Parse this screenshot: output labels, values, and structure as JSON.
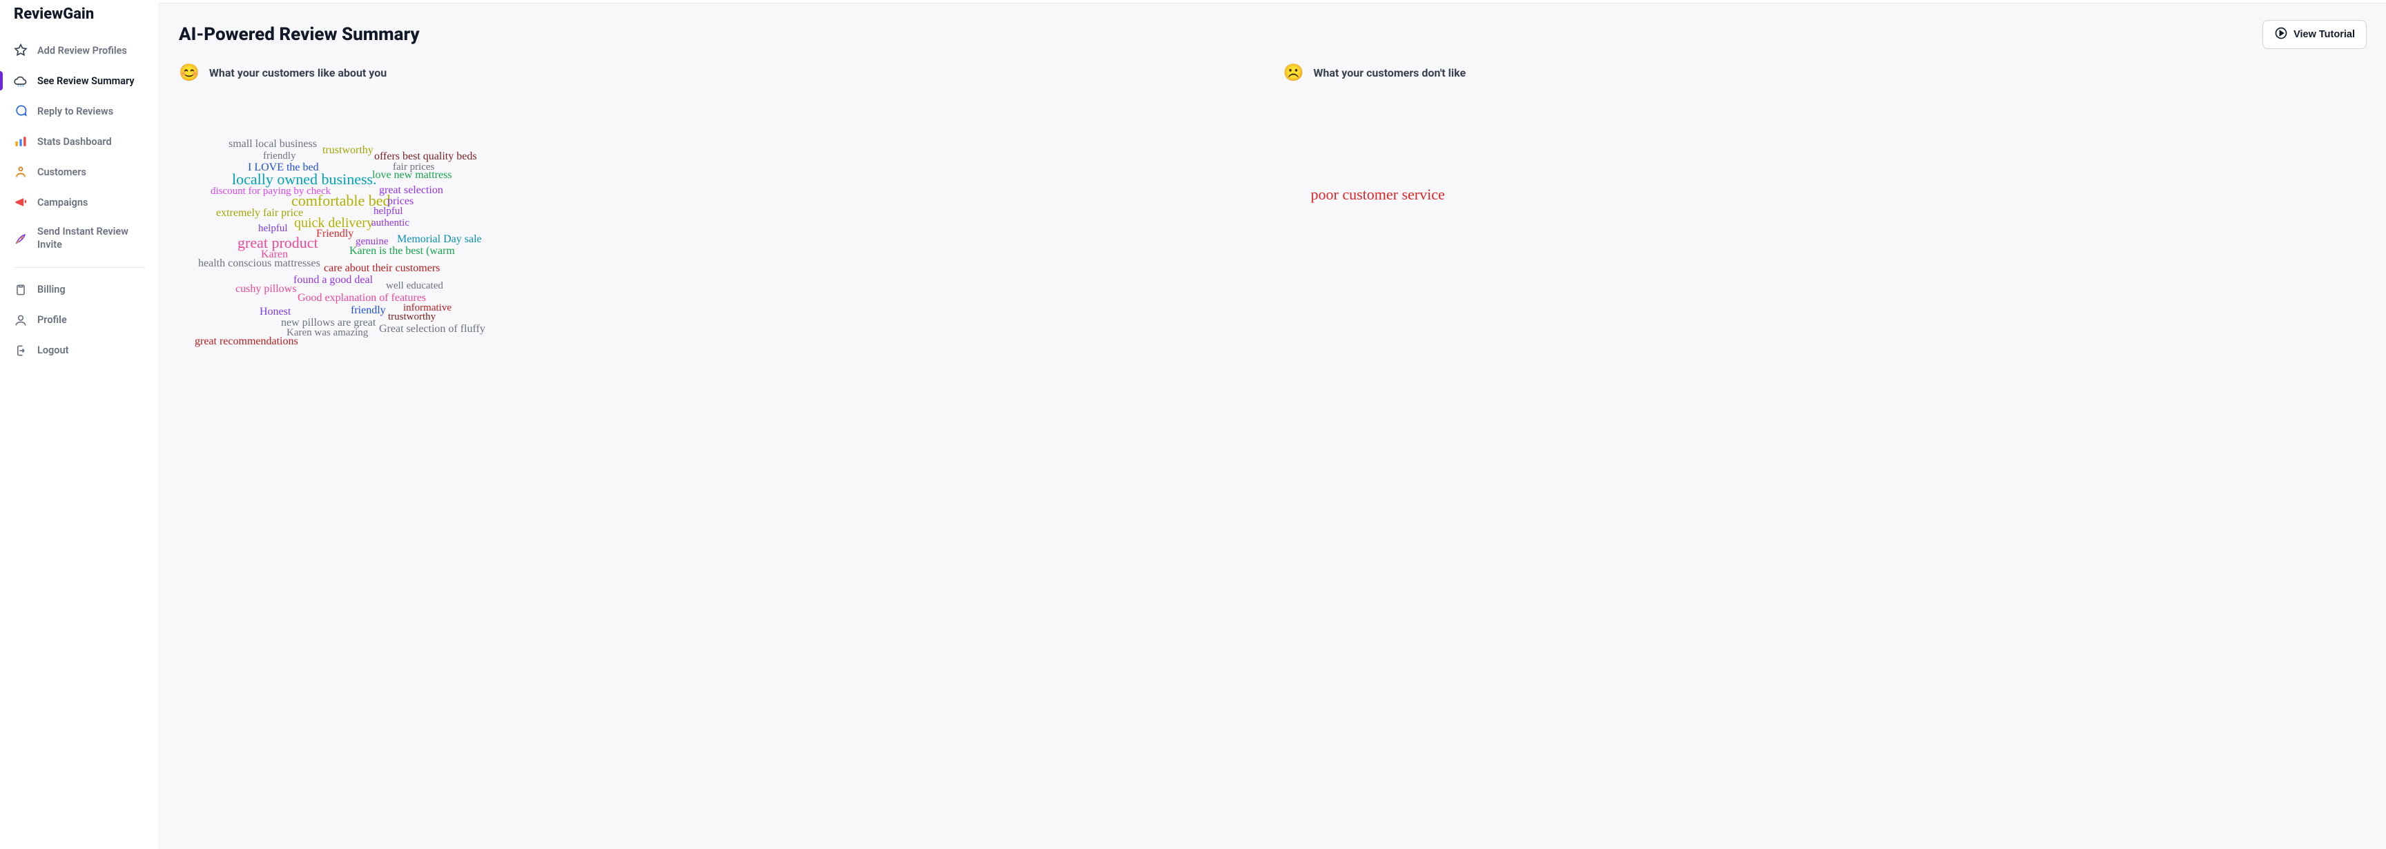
{
  "brand": "ReviewGain",
  "nav": {
    "add_profiles": "Add Review Profiles",
    "see_summary": "See Review Summary",
    "reply_reviews": "Reply to Reviews",
    "stats": "Stats Dashboard",
    "customers": "Customers",
    "campaigns": "Campaigns",
    "send_invite": "Send Instant Review Invite",
    "billing": "Billing",
    "profile": "Profile",
    "logout": "Logout"
  },
  "page": {
    "title": "AI-Powered Review Summary",
    "tutorial_label": "View Tutorial"
  },
  "positive": {
    "heading": "What your customers like about you",
    "words": {
      "p1": "small local business",
      "p2": "friendly",
      "p3": "trustworthy",
      "p4": "offers best quality beds",
      "p5": "I LOVE the bed",
      "p6": "fair prices",
      "p7": "locally owned business.",
      "p8": "love new mattress",
      "p9": "discount for paying by check",
      "p10": "great selection",
      "p11": "comfortable bed",
      "p12": "prices",
      "p13": "extremely fair price",
      "p14": "helpful",
      "p15": "quick delivery",
      "p16": "authentic",
      "p17": "helpful",
      "p18": "Friendly",
      "p19": "genuine",
      "p20": "Memorial Day sale",
      "p21": "great product",
      "p22": "Karen is the best (warm",
      "p23": "Karen",
      "p24": "health conscious mattresses",
      "p25": "care about their customers",
      "p26": "found a good deal",
      "p27": "well educated",
      "p28": "cushy pillows",
      "p29": "Good explanation of features",
      "p30": "friendly",
      "p31": "informative",
      "p32": "Honest",
      "p33": "trustworthy",
      "p34": "new pillows are great",
      "p35": "Great selection of fluffy",
      "p36": "Karen was amazing",
      "p37": "great recommendations"
    }
  },
  "negative": {
    "heading": "What your customers don't like",
    "words": {
      "n1": "poor customer service"
    }
  }
}
